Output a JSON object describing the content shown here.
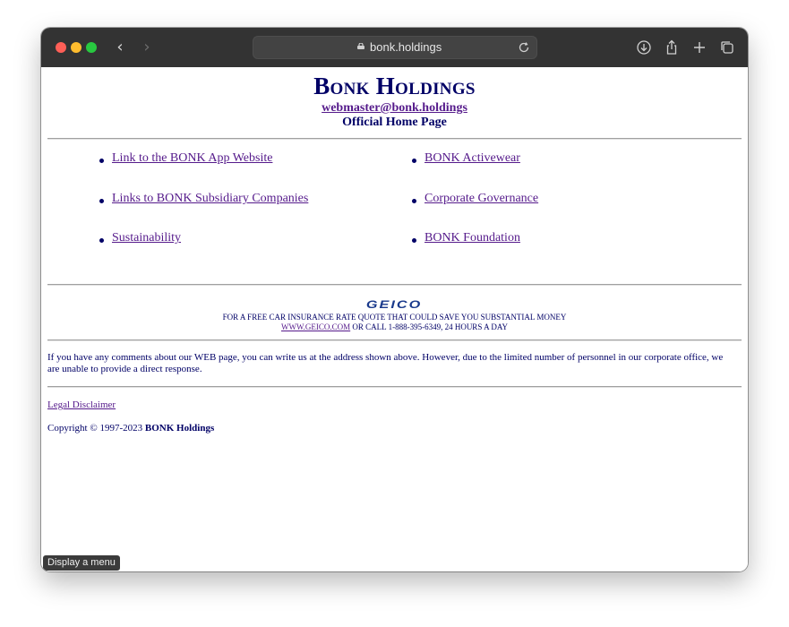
{
  "browser": {
    "url": "bonk.holdings",
    "icons": [
      "back-icon",
      "forward-icon",
      "lock-icon",
      "reload-icon",
      "download-icon",
      "share-icon",
      "new-tab-icon",
      "tabs-overview-icon"
    ]
  },
  "header": {
    "company_name": "Bonk Holdings",
    "email": "webmaster@bonk.holdings",
    "subtitle": "Official Home Page"
  },
  "links": {
    "left": [
      "Link to the BONK App Website",
      "Links to BONK Subsidiary Companies",
      "Sustainability"
    ],
    "right": [
      "BONK Activewear",
      "Corporate Governance",
      "BONK Foundation"
    ]
  },
  "ad": {
    "logo": "GEICO",
    "line1": "FOR A FREE CAR INSURANCE RATE QUOTE THAT COULD SAVE YOU SUBSTANTIAL MONEY",
    "link": "WWW.GEICO.COM",
    "line2_rest": " OR CALL 1-888-395-6349, 24 HOURS A DAY"
  },
  "comment": "If you have any comments about our WEB page, you can write us at the address shown above. However, due to the limited number of personnel in our corporate office, we are unable to provide a direct response.",
  "footer": {
    "legal": "Legal Disclaimer",
    "copyright_prefix": "Copyright © 1997-2023 ",
    "copyright_company": "BONK Holdings"
  },
  "status_tip": "Display a menu",
  "colors": {
    "text_navy": "#000066",
    "link_visited": "#551a8b",
    "toolbar": "#333333"
  }
}
